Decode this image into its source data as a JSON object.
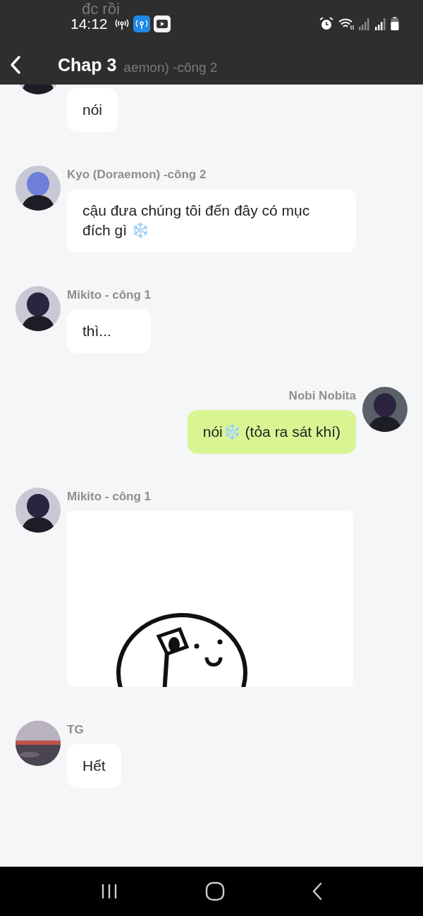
{
  "status_bar": {
    "time": "14:12",
    "behind_text": "đc rồi"
  },
  "header": {
    "title": "Chap 3",
    "behind_text": "aemon) -công 2"
  },
  "messages": [
    {
      "kind": "received",
      "text": "nói"
    },
    {
      "kind": "received",
      "name": "Kyo (Doraemon) -công 2",
      "text": "cậu đưa chúng tôi đến đây có mục đích gì ❄️"
    },
    {
      "kind": "received",
      "name": "Mikito - công 1",
      "text": "thì..."
    },
    {
      "kind": "sent",
      "name": "Nobi Nobita",
      "text": "nói❄️ (tỏa ra sát khí)"
    },
    {
      "name": "Mikito - công 1"
    },
    {
      "kind": "received",
      "name": "TG",
      "text": "Hết"
    }
  ]
}
